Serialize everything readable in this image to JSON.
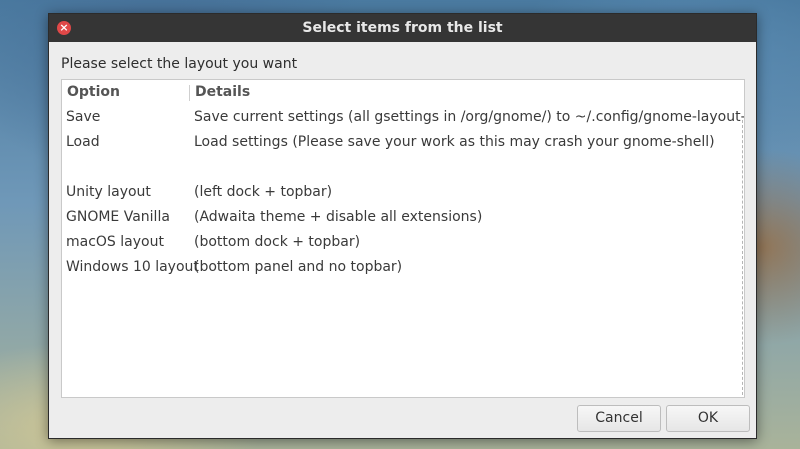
{
  "dialog": {
    "title": "Select items from the list",
    "close_icon": "close-icon",
    "prompt": "Please select the layout you want"
  },
  "list": {
    "columns": [
      "Option",
      "Details"
    ],
    "rows": [
      {
        "option": "Save",
        "details": "Save current settings (all gsettings in /org/gnome/) to ~/.config/gnome-layout-manager"
      },
      {
        "option": "Load",
        "details": "Load settings (Please save your work as this may crash your gnome-shell)"
      },
      {
        "option": "",
        "details": ""
      },
      {
        "option": "Unity layout",
        "details": "(left dock + topbar)"
      },
      {
        "option": "GNOME Vanilla",
        "details": "(Adwaita theme + disable all extensions)"
      },
      {
        "option": "macOS layout",
        "details": "(bottom dock + topbar)"
      },
      {
        "option": "Windows 10 layout",
        "details": "(bottom panel and no topbar)"
      }
    ]
  },
  "buttons": {
    "cancel": "Cancel",
    "ok": "OK"
  }
}
